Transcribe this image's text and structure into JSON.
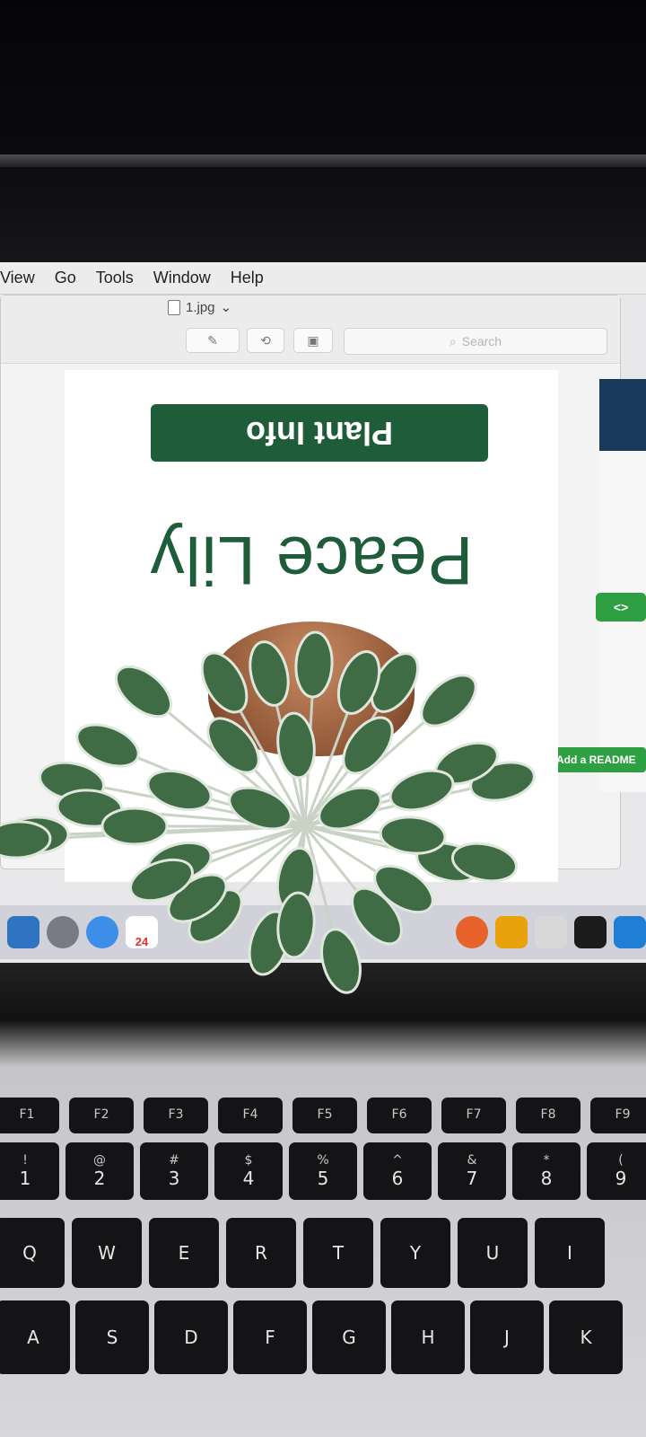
{
  "menubar": {
    "items": [
      "View",
      "Go",
      "Tools",
      "Window",
      "Help"
    ]
  },
  "preview_window": {
    "file_title": "1.jpg",
    "search_placeholder": "Search"
  },
  "document": {
    "banner_text": "Plant Info",
    "plant_name": "Peace Lily"
  },
  "side_panel": {
    "code_button": "<>",
    "readme_button": "Add a README"
  },
  "dock": {
    "calendar_date": "24"
  },
  "keyboard": {
    "fn_row": [
      "F1",
      "F2",
      "F3",
      "F4",
      "F5",
      "F6",
      "F7",
      "F8",
      "F9"
    ],
    "number_row": [
      {
        "top": "!",
        "bottom": "1"
      },
      {
        "top": "@",
        "bottom": "2"
      },
      {
        "top": "#",
        "bottom": "3"
      },
      {
        "top": "$",
        "bottom": "4"
      },
      {
        "top": "%",
        "bottom": "5"
      },
      {
        "top": "^",
        "bottom": "6"
      },
      {
        "top": "&",
        "bottom": "7"
      },
      {
        "top": "*",
        "bottom": "8"
      },
      {
        "top": "(",
        "bottom": "9"
      }
    ],
    "letter_row_1": [
      "Q",
      "W",
      "E",
      "R",
      "T",
      "Y",
      "U",
      "I"
    ],
    "letter_row_2": [
      "A",
      "S",
      "D",
      "F",
      "G",
      "H",
      "J",
      "K"
    ]
  },
  "colors": {
    "banner_green": "#1f5c3a",
    "text_green": "#1f5c3a",
    "github_green": "#2ea043"
  }
}
